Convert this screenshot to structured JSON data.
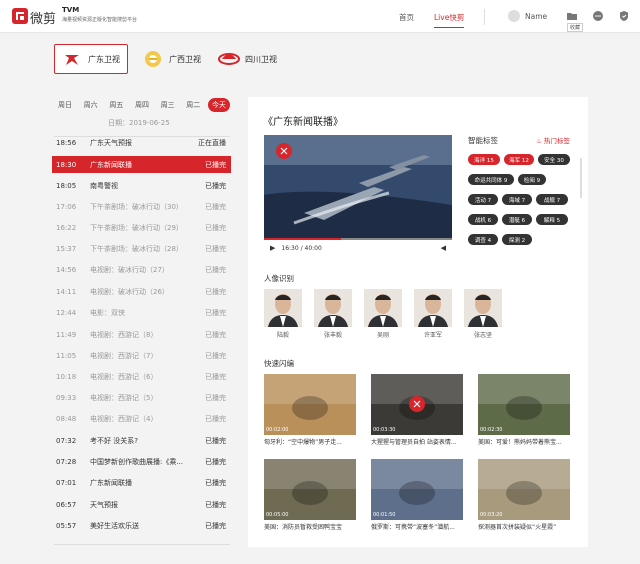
{
  "header": {
    "logo_text": "微剪",
    "tvm": "TVM",
    "subtitle": "海量视频资源正版化智能搜剪平台",
    "nav": [
      "首页",
      "Live快剪"
    ],
    "user": "Name",
    "fav_label": "收藏"
  },
  "channels": [
    {
      "label": "广东卫视",
      "color": "#d6262b"
    },
    {
      "label": "广西卫视",
      "color": "#e7b21b"
    },
    {
      "label": "四川卫视",
      "color": "#d6262b"
    }
  ],
  "days": [
    "周日",
    "周六",
    "周五",
    "周四",
    "周三",
    "周二",
    "今天"
  ],
  "date": "日期：2019-06-25",
  "programs": [
    {
      "time": "18:56",
      "name": "广东天气预报",
      "status": "正在直播",
      "state": "dark"
    },
    {
      "time": "18:30",
      "name": "广东新闻联播",
      "status": "已播完",
      "state": "sel"
    },
    {
      "time": "18:05",
      "name": "南粤警视",
      "status": "已播完",
      "state": "dark"
    },
    {
      "time": "17:06",
      "name": "下午茶剧场：破冰行动（30）",
      "status": "已播完",
      "state": "past"
    },
    {
      "time": "16:22",
      "name": "下午茶剧场：破冰行动（29）",
      "status": "已播完",
      "state": "past"
    },
    {
      "time": "15:37",
      "name": "下午茶剧场：破冰行动（28）",
      "status": "已播完",
      "state": "past"
    },
    {
      "time": "14:56",
      "name": "电视剧：破冰行动（27）",
      "status": "已播完",
      "state": "past"
    },
    {
      "time": "14:11",
      "name": "电视剧：破冰行动（26）",
      "status": "已播完",
      "state": "past"
    },
    {
      "time": "12:44",
      "name": "电影：双侠",
      "status": "已播完",
      "state": "past"
    },
    {
      "time": "11:49",
      "name": "电视剧：西游记（8）",
      "status": "已播完",
      "state": "past"
    },
    {
      "time": "11:05",
      "name": "电视剧：西游记（7）",
      "status": "已播完",
      "state": "past"
    },
    {
      "time": "10:18",
      "name": "电视剧：西游记（6）",
      "status": "已播完",
      "state": "past"
    },
    {
      "time": "09:33",
      "name": "电视剧：西游记（5）",
      "status": "已播完",
      "state": "past"
    },
    {
      "time": "08:48",
      "name": "电视剧：西游记（4）",
      "status": "已播完",
      "state": "past"
    },
    {
      "time": "07:32",
      "name": "考不好 没关系?",
      "status": "已播完",
      "state": "dark"
    },
    {
      "time": "07:28",
      "name": "中国梦新创作歌曲展播:《乘...",
      "status": "已播完",
      "state": "dark"
    },
    {
      "time": "07:01",
      "name": "广东新闻联播",
      "status": "已播完",
      "state": "dark"
    },
    {
      "time": "06:57",
      "name": "天气预报",
      "status": "已播完",
      "state": "dark"
    },
    {
      "time": "05:57",
      "name": "美好生活欢乐送",
      "status": "已播完",
      "state": "dark"
    }
  ],
  "program_title": "《广东新闻联播》",
  "player": {
    "time": "16:30 / 40:00",
    "progress": 0.41
  },
  "smart_tags": {
    "title": "智能标签",
    "hot": "热门标签",
    "tags": [
      {
        "label": "海洋 15",
        "red": true
      },
      {
        "label": "海军 12",
        "red": true
      },
      {
        "label": "安全 30",
        "red": false
      },
      {
        "label": "命运共同体 9",
        "red": false
      },
      {
        "label": "检阅 9",
        "red": false
      },
      {
        "label": "活动 7",
        "red": false
      },
      {
        "label": "海域 7",
        "red": false
      },
      {
        "label": "战舰 7",
        "red": false
      },
      {
        "label": "战机 6",
        "red": false
      },
      {
        "label": "潜艇 6",
        "red": false
      },
      {
        "label": "解释 5",
        "red": false
      },
      {
        "label": "调查 4",
        "red": false
      },
      {
        "label": "探测 2",
        "red": false
      }
    ]
  },
  "faces": {
    "title": "人像识别",
    "people": [
      "陆毅",
      "张丰毅",
      "吴刚",
      "许亚军",
      "张志坚"
    ]
  },
  "clips": {
    "title": "快速闪编",
    "items": [
      {
        "caption": "匈牙利：“空中爆物”男子走...",
        "time": "00:02:00",
        "color": "#b98f5a"
      },
      {
        "caption": "大猩猩与管理员自拍 站姿表情...",
        "time": "00:03:30",
        "color": "#3b3a36"
      },
      {
        "caption": "美国：可爱！熊妈妈带着熊宝...",
        "time": "00:02:30",
        "color": "#5d6b48"
      },
      {
        "caption": "美国：消防员暂救受困鸭宝宝",
        "time": "00:05:00",
        "color": "#6f6a52"
      },
      {
        "caption": "俄罗斯：可携带“波塞冬”潜航...",
        "time": "00:01:50",
        "color": "#5e6f8c"
      },
      {
        "caption": "探测器首次拼装疑似“火星霞”",
        "time": "00:03:20",
        "color": "#a89a7c"
      }
    ]
  }
}
